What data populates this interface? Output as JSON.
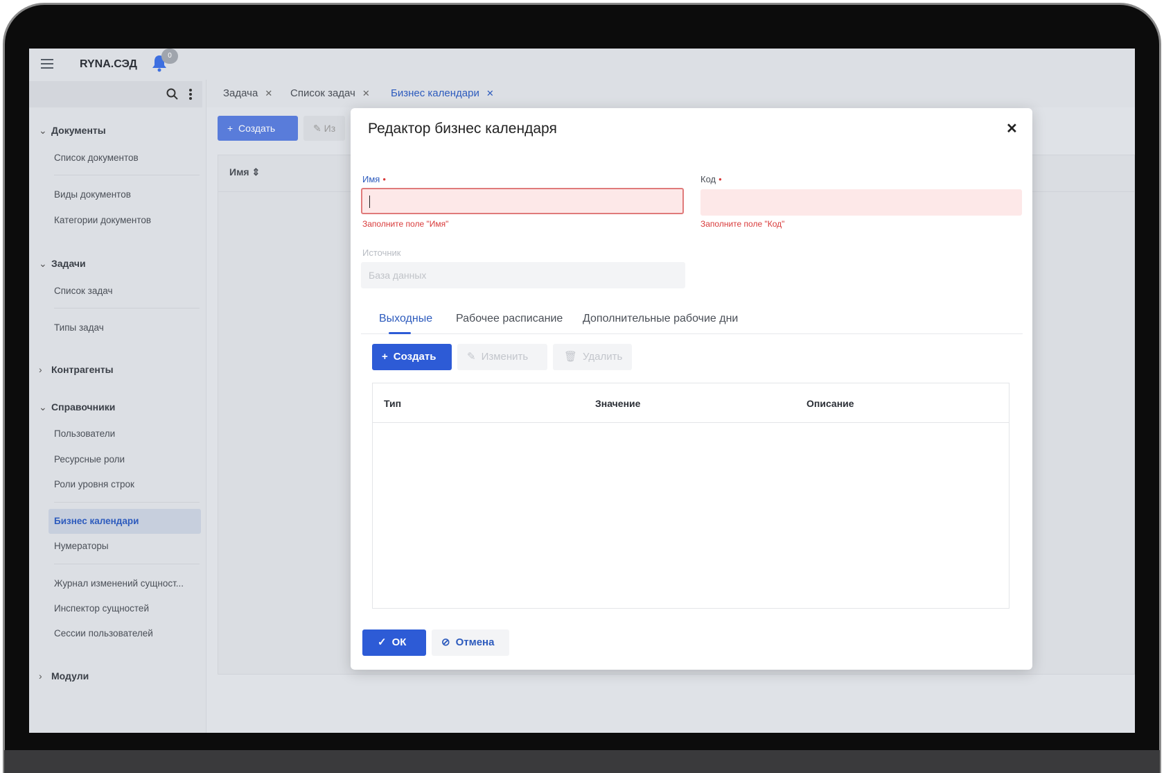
{
  "app": {
    "title": "RYNA.СЭД",
    "notifications": "0"
  },
  "sidebar": {
    "groups": [
      {
        "label": "Документы",
        "items": [
          "Список документов",
          "Виды документов",
          "Категории документов"
        ]
      },
      {
        "label": "Задачи",
        "items": [
          "Список задач",
          "Типы задач"
        ]
      },
      {
        "label": "Контрагенты"
      },
      {
        "label": "Справочники",
        "items": [
          "Пользователи",
          "Ресурсные роли",
          "Роли уровня строк",
          "Бизнес календари",
          "Нумераторы",
          "Журнал изменений сущност...",
          "Инспектор сущностей",
          "Сессии пользователей"
        ]
      },
      {
        "label": "Модули"
      }
    ],
    "active_item": "Бизнес календари"
  },
  "tabs": [
    {
      "label": "Задача"
    },
    {
      "label": "Список задач"
    },
    {
      "label": "Бизнес календари",
      "active": true
    }
  ],
  "workspace": {
    "create_label": "Создать",
    "edit_label": "Из",
    "column_name": "Имя"
  },
  "modal": {
    "title": "Редактор бизнес календаря",
    "fields": {
      "name": {
        "label": "Имя",
        "value": "",
        "error": "Заполните поле \"Имя\""
      },
      "code": {
        "label": "Код",
        "value": "",
        "error": "Заполните поле \"Код\""
      },
      "source": {
        "label": "Источник",
        "value": "База данных"
      }
    },
    "tabs": [
      "Выходные",
      "Рабочее расписание",
      "Дополнительные рабочие дни"
    ],
    "active_tab": "Выходные",
    "toolbar": {
      "create": "Создать",
      "edit": "Изменить",
      "delete": "Удалить"
    },
    "table": {
      "columns": [
        "Тип",
        "Значение",
        "Описание"
      ],
      "rows": []
    },
    "footer": {
      "ok": "ОК",
      "cancel": "Отмена"
    }
  },
  "colors": {
    "accent": "#2d5bd6",
    "error": "#d83a3a",
    "error_bg": "#fde8e8"
  }
}
